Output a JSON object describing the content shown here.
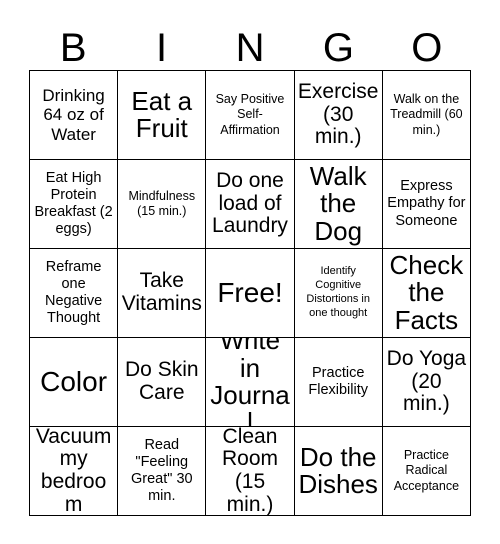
{
  "card": {
    "title": "Bingo Card",
    "header_letters": [
      "B",
      "I",
      "N",
      "G",
      "O"
    ],
    "background_color": "#ffffff",
    "line_color": "#000000",
    "text_color": "#000000",
    "rows": 5,
    "columns": 5,
    "free_space_index": 12,
    "cells": [
      {
        "text": "Drinking 64 oz of Water",
        "size": "md"
      },
      {
        "text": "Eat a Fruit",
        "size": "xl"
      },
      {
        "text": "Say Positive Self-Affirmation",
        "size": "xs"
      },
      {
        "text": "Exercise (30 min.)",
        "size": "lg"
      },
      {
        "text": "Walk on the Treadmill (60 min.)",
        "size": "xs"
      },
      {
        "text": "Eat High Protein Breakfast (2 eggs)",
        "size": "sm"
      },
      {
        "text": "Mindfulness (15 min.)",
        "size": "xs"
      },
      {
        "text": "Do one load of Laundry",
        "size": "lg"
      },
      {
        "text": "Walk the Dog",
        "size": "xl"
      },
      {
        "text": "Express Empathy for Someone",
        "size": "sm"
      },
      {
        "text": "Reframe one Negative Thought",
        "size": "sm"
      },
      {
        "text": "Take Vitamins",
        "size": "lg"
      },
      {
        "text": "Free!",
        "size": "xxl"
      },
      {
        "text": "Identify Cognitive Distortions in one thought",
        "size": "xxs"
      },
      {
        "text": "Check the Facts",
        "size": "xl"
      },
      {
        "text": "Color",
        "size": "xxl"
      },
      {
        "text": "Do Skin Care",
        "size": "lg"
      },
      {
        "text": "Write in Journal",
        "size": "xl"
      },
      {
        "text": "Practice Flexibility",
        "size": "sm"
      },
      {
        "text": "Do Yoga (20 min.)",
        "size": "lg"
      },
      {
        "text": "Vacuum my bedroom",
        "size": "lg"
      },
      {
        "text": "Read \"Feeling Great\" 30 min.",
        "size": "sm"
      },
      {
        "text": "Clean Room (15 min.)",
        "size": "lg"
      },
      {
        "text": "Do the Dishes",
        "size": "xl"
      },
      {
        "text": "Practice Radical Acceptance",
        "size": "xs"
      }
    ]
  }
}
